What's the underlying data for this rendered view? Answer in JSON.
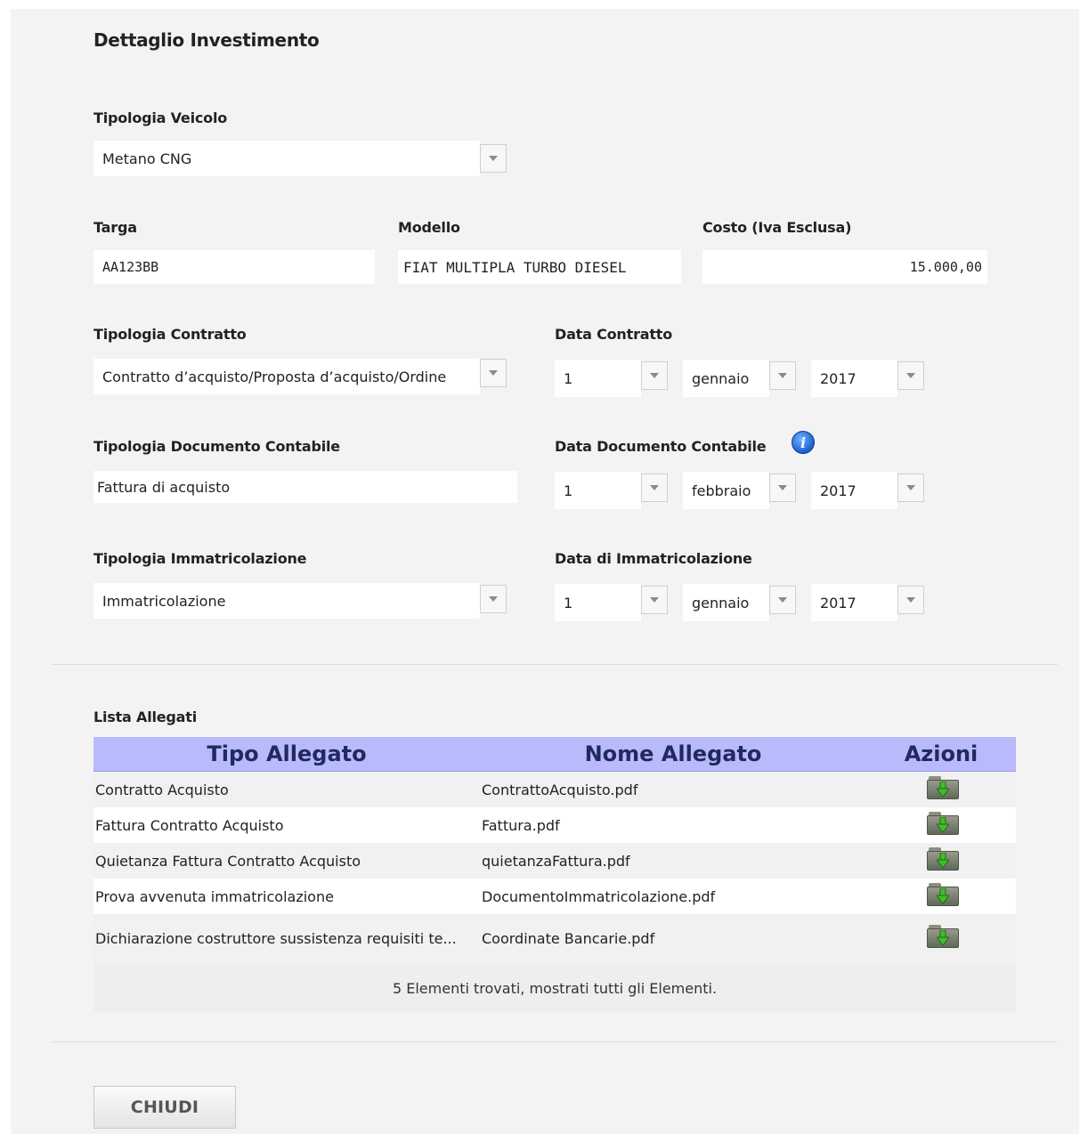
{
  "title": "Dettaglio Investimento",
  "vehicle_type": {
    "label": "Tipologia Veicolo",
    "value": "Metano CNG"
  },
  "plate": {
    "label": "Targa",
    "value": "AA123BB"
  },
  "model": {
    "label": "Modello",
    "value": "FIAT MULTIPLA TURBO DIESEL"
  },
  "cost": {
    "label": "Costo (Iva Esclusa)",
    "value": "15.000,00"
  },
  "contract_type": {
    "label": "Tipologia Contratto",
    "value": "Contratto d’acquisto/Proposta d’acquisto/Ordine"
  },
  "contract_date": {
    "label": "Data Contratto",
    "day": "1",
    "month": "gennaio",
    "year": "2017"
  },
  "doc_type": {
    "label": "Tipologia Documento Contabile",
    "value": "Fattura di acquisto"
  },
  "doc_date": {
    "label": "Data Documento Contabile",
    "day": "1",
    "month": "febbraio",
    "year": "2017",
    "icon": "info-icon"
  },
  "registration_type": {
    "label": "Tipologia Immatricolazione",
    "value": "Immatricolazione"
  },
  "registration_date": {
    "label": "Data di Immatricolazione",
    "day": "1",
    "month": "gennaio",
    "year": "2017"
  },
  "attachments": {
    "title": "Lista Allegati",
    "headers": {
      "type": "Tipo Allegato",
      "name": "Nome Allegato",
      "actions": "Azioni"
    },
    "rows": [
      {
        "type": "Contratto Acquisto",
        "name": "ContrattoAcquisto.pdf",
        "action_icon": "download-icon"
      },
      {
        "type": "Fattura Contratto Acquisto",
        "name": "Fattura.pdf",
        "action_icon": "download-icon"
      },
      {
        "type": "Quietanza Fattura Contratto Acquisto",
        "name": "quietanzaFattura.pdf",
        "action_icon": "download-icon"
      },
      {
        "type": "Prova avvenuta immatricolazione",
        "name": "DocumentoImmatricolazione.pdf",
        "action_icon": "download-icon"
      },
      {
        "type": "Dichiarazione costruttore sussistenza requisiti te...",
        "name": "Coordinate Bancarie.pdf",
        "action_icon": "download-icon"
      }
    ],
    "footer": "5 Elementi trovati, mostrati tutti gli Elementi.",
    "header_color": "#b8bafc"
  },
  "close_button": "CHIUDI"
}
